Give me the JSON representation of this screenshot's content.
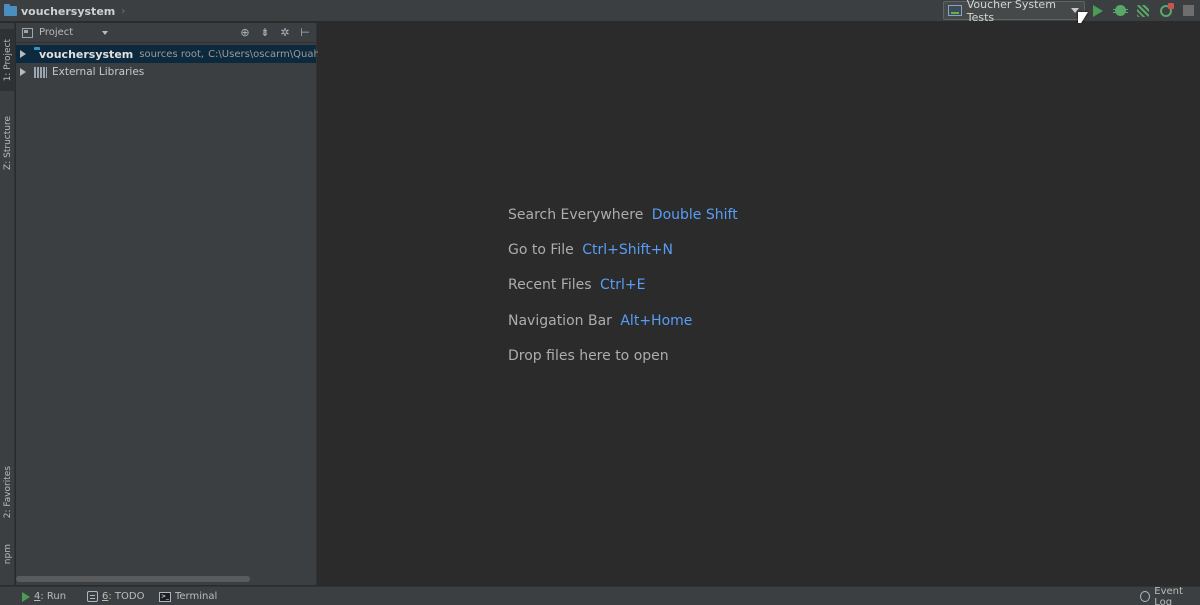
{
  "breadcrumb": {
    "project": "vouchersystem",
    "separator": "›"
  },
  "toolbar": {
    "run_config": "Voucher System Tests",
    "buttons": [
      {
        "name": "run-button",
        "icon": "play-icon",
        "color": "#499c54"
      },
      {
        "name": "debug-button",
        "icon": "bug-icon",
        "color": "#59a869"
      },
      {
        "name": "coverage-button",
        "icon": "coverage-icon",
        "color": "#59a869"
      },
      {
        "name": "profile-button",
        "icon": "profile-icon",
        "color": "#59a869"
      },
      {
        "name": "stop-button",
        "icon": "stop-icon",
        "color": "#6e6e6e"
      }
    ]
  },
  "left_strip": {
    "tabs": [
      {
        "label": "1: Project",
        "active": true
      },
      {
        "label": "Z: Structure",
        "active": false
      },
      {
        "label": "2: Favorites",
        "active": false
      },
      {
        "label": "npm",
        "active": false
      }
    ]
  },
  "project_panel": {
    "view_label": "Project",
    "header_icons": [
      "target-icon",
      "collapse-icon",
      "gear-icon",
      "hide-icon"
    ],
    "tree": [
      {
        "name": "vouchersystem",
        "hint": "sources root,",
        "path": "C:\\Users\\oscarm\\Quaho",
        "selected": true
      },
      {
        "name": "External Libraries",
        "selected": false
      }
    ]
  },
  "editor": {
    "hints": [
      {
        "label": "Search Everywhere",
        "shortcut": "Double Shift"
      },
      {
        "label": "Go to File",
        "shortcut": "Ctrl+Shift+N"
      },
      {
        "label": "Recent Files",
        "shortcut": "Ctrl+E"
      },
      {
        "label": "Navigation Bar",
        "shortcut": "Alt+Home"
      },
      {
        "label": "Drop files here to open",
        "shortcut": ""
      }
    ],
    "shortcut_color": "#589df6"
  },
  "bottom_bar": {
    "tabs": [
      {
        "num": "4",
        "label": ": Run"
      },
      {
        "num": "6",
        "label": ": TODO"
      },
      {
        "num": "",
        "label": "Terminal"
      }
    ],
    "event_log": "Event Log"
  }
}
